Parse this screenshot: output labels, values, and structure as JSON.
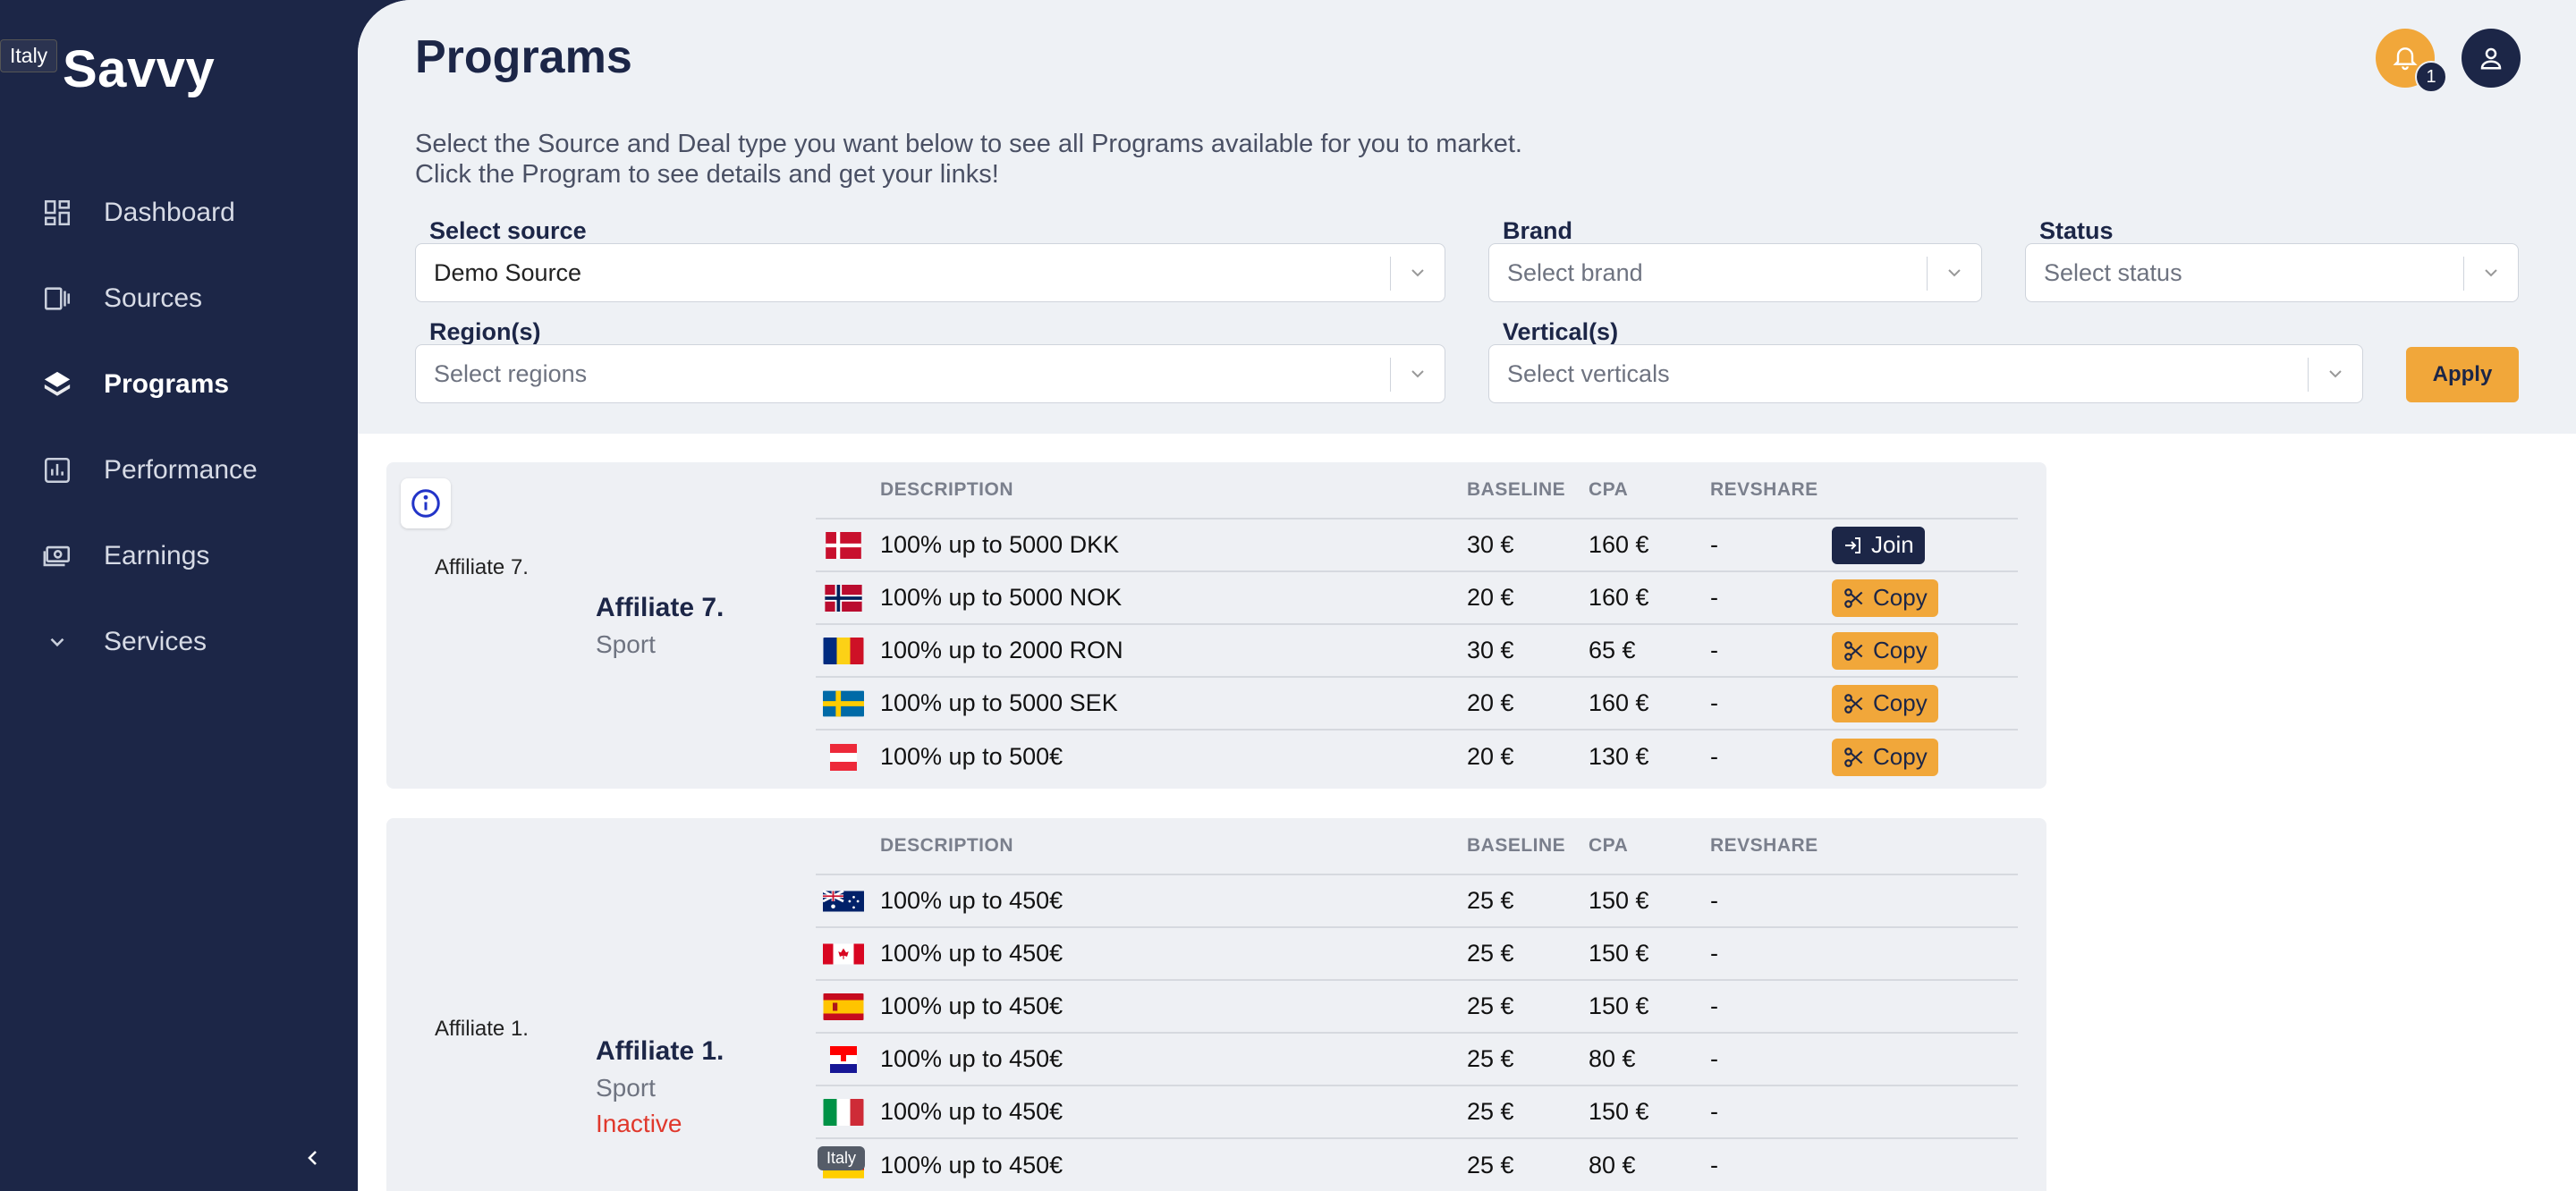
{
  "app": {
    "name": "Savvy",
    "tooltip": "Italy"
  },
  "sidebar": {
    "items": [
      {
        "label": "Dashboard",
        "icon": "dashboard-icon",
        "active": false
      },
      {
        "label": "Sources",
        "icon": "sources-icon",
        "active": false
      },
      {
        "label": "Programs",
        "icon": "layers-icon",
        "active": true
      },
      {
        "label": "Performance",
        "icon": "chart-icon",
        "active": false
      },
      {
        "label": "Earnings",
        "icon": "money-icon",
        "active": false
      },
      {
        "label": "Services",
        "icon": "chevron-down-icon",
        "active": false
      }
    ]
  },
  "header": {
    "title": "Programs",
    "notifications": "1",
    "intro_line1": "Select the Source and Deal type you want below to see all Programs available for you to market.",
    "intro_line2": "Click the Program to see details and get your links!"
  },
  "filters": {
    "source_label": "Select source",
    "source_value": "Demo Source",
    "brand_label": "Brand",
    "brand_placeholder": "Select brand",
    "status_label": "Status",
    "status_placeholder": "Select status",
    "regions_label": "Region(s)",
    "regions_placeholder": "Select regions",
    "verticals_label": "Vertical(s)",
    "verticals_placeholder": "Select verticals",
    "apply_label": "Apply"
  },
  "table_headers": {
    "description": "DESCRIPTION",
    "baseline": "BASELINE",
    "cpa": "CPA",
    "revshare": "REVSHARE"
  },
  "programs": [
    {
      "logo_alt": "Affiliate 7.",
      "name": "Affiliate 7.",
      "category": "Sport",
      "status": "",
      "rows": [
        {
          "flag": "DK",
          "description": "100% up to 5000 DKK",
          "baseline": "30 €",
          "cpa": "160 €",
          "revshare": "-",
          "action": "Join"
        },
        {
          "flag": "NO",
          "description": "100% up to 5000 NOK",
          "baseline": "20 €",
          "cpa": "160 €",
          "revshare": "-",
          "action": "Copy"
        },
        {
          "flag": "RO",
          "description": "100% up to 2000 RON",
          "baseline": "30 €",
          "cpa": "65 €",
          "revshare": "-",
          "action": "Copy"
        },
        {
          "flag": "SE",
          "description": "100% up to 5000 SEK",
          "baseline": "20 €",
          "cpa": "160 €",
          "revshare": "-",
          "action": "Copy"
        },
        {
          "flag": "AT",
          "description": "100% up to 500€",
          "baseline": "20 €",
          "cpa": "130 €",
          "revshare": "-",
          "action": "Copy"
        }
      ]
    },
    {
      "logo_alt": "Affiliate 1.",
      "name": "Affiliate 1.",
      "category": "Sport",
      "status": "Inactive",
      "rows": [
        {
          "flag": "AU",
          "description": "100% up to 450€",
          "baseline": "25 €",
          "cpa": "150 €",
          "revshare": "-",
          "action": ""
        },
        {
          "flag": "CA",
          "description": "100% up to 450€",
          "baseline": "25 €",
          "cpa": "150 €",
          "revshare": "-",
          "action": ""
        },
        {
          "flag": "ES",
          "description": "100% up to 450€",
          "baseline": "25 €",
          "cpa": "150 €",
          "revshare": "-",
          "action": ""
        },
        {
          "flag": "HR",
          "description": "100% up to 450€",
          "baseline": "25 €",
          "cpa": "80 €",
          "revshare": "-",
          "action": ""
        },
        {
          "flag": "IT",
          "description": "100% up to 450€",
          "baseline": "25 €",
          "cpa": "150 €",
          "revshare": "-",
          "action": ""
        },
        {
          "flag": "DE",
          "description": "100% up to 450€",
          "baseline": "25 €",
          "cpa": "80 €",
          "revshare": "-",
          "action": ""
        }
      ]
    }
  ],
  "flag_tooltip": "Italy"
}
